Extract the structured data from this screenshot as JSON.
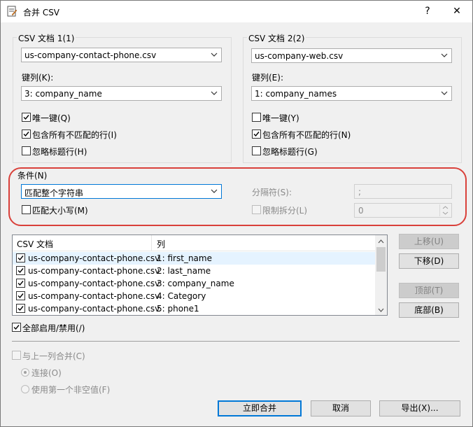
{
  "window": {
    "title": "合并 CSV",
    "help_label": "?",
    "close_label": "✕"
  },
  "doc1": {
    "group_label": "CSV 文档 1(1)",
    "file_value": "us-company-contact-phone.csv",
    "key_label": "键列(K):",
    "key_value": "3: company_name",
    "unique_key_label": "唯一键(Q)",
    "include_unmatched_label": "包含所有不匹配的行(I)",
    "ignore_header_label": "忽略标题行(H)",
    "unique_key_checked": true,
    "include_unmatched_checked": true,
    "ignore_header_checked": false
  },
  "doc2": {
    "group_label": "CSV 文档 2(2)",
    "file_value": "us-company-web.csv",
    "key_label": "键列(E):",
    "key_value": "1: company_names",
    "unique_key_label": "唯一键(Y)",
    "include_unmatched_label": "包含所有不匹配的行(N)",
    "ignore_header_label": "忽略标题行(G)",
    "unique_key_checked": false,
    "include_unmatched_checked": true,
    "ignore_header_checked": false
  },
  "condition": {
    "group_label": "条件(N)",
    "match_value": "匹配整个字符串",
    "match_case_label": "匹配大小写(M)",
    "separator_label": "分隔符(S):",
    "separator_value": ";",
    "limit_split_label": "限制拆分(L)",
    "limit_split_value": "0"
  },
  "columns_list": {
    "header_doc": "CSV 文档",
    "header_col": "列",
    "rows": [
      {
        "doc": "us-company-contact-phone.csv",
        "col": "1: first_name"
      },
      {
        "doc": "us-company-contact-phone.csv",
        "col": "2: last_name"
      },
      {
        "doc": "us-company-contact-phone.csv",
        "col": "3: company_name"
      },
      {
        "doc": "us-company-contact-phone.csv",
        "col": "4: Category"
      },
      {
        "doc": "us-company-contact-phone.csv",
        "col": "5: phone1"
      }
    ]
  },
  "side_buttons": {
    "move_up": "上移(U)",
    "move_down": "下移(D)",
    "top": "顶部(T)",
    "bottom": "底部(B)"
  },
  "enable_all_label": "全部启用/禁用(/)",
  "merge_prev_label": "与上一列合并(C)",
  "join_label": "连接(O)",
  "first_nonempty_label": "使用第一个非空值(F)",
  "footer": {
    "merge_now": "立即合并",
    "cancel": "取消",
    "export": "导出(X)..."
  },
  "accent_color": "#0078d7",
  "highlight_color": "#d9403a"
}
